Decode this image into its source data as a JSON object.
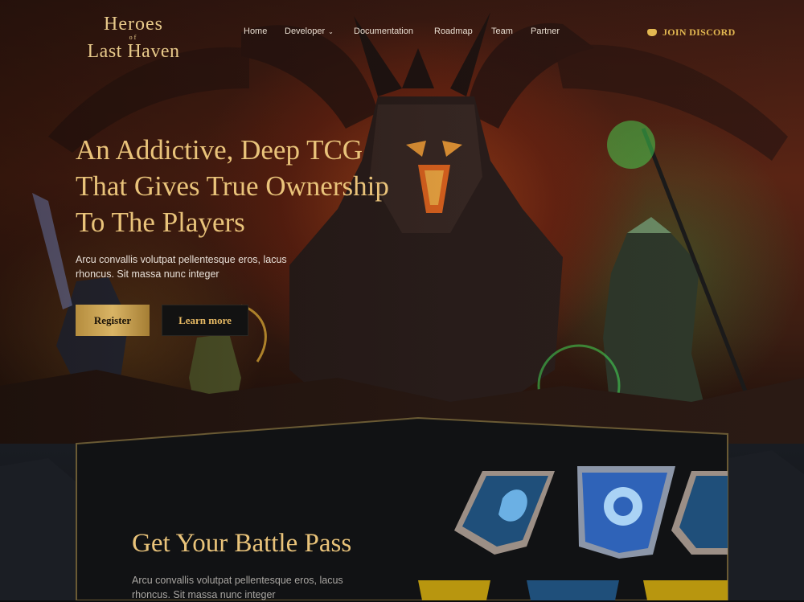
{
  "logo": {
    "line1": "Heroes",
    "line2": "of",
    "line3": "Last Haven"
  },
  "nav": {
    "items": [
      {
        "label": "Home"
      },
      {
        "label": "Developer",
        "has_dropdown": true
      },
      {
        "label": "Documentation"
      },
      {
        "label": "Roadmap"
      },
      {
        "label": "Team"
      },
      {
        "label": "Partner"
      }
    ],
    "discord_label": "JOIN DISCORD"
  },
  "hero": {
    "headline_line1": "An Addictive, Deep TCG",
    "headline_line2": "That Gives True Ownership",
    "headline_line3": "To The Players",
    "subtext": "Arcu convallis volutpat pellentesque eros, lacus rhoncus. Sit massa nunc integer",
    "register_label": "Register",
    "learn_more_label": "Learn more"
  },
  "battle_pass": {
    "title": "Get Your Battle Pass",
    "subtext": "Arcu convallis volutpat pellentesque eros, lacus rhoncus. Sit massa nunc integer"
  },
  "colors": {
    "gold": "#e9c37a",
    "accent_gold": "#e3b851",
    "panel": "#111214",
    "banner_blue": "#2f63b8"
  }
}
